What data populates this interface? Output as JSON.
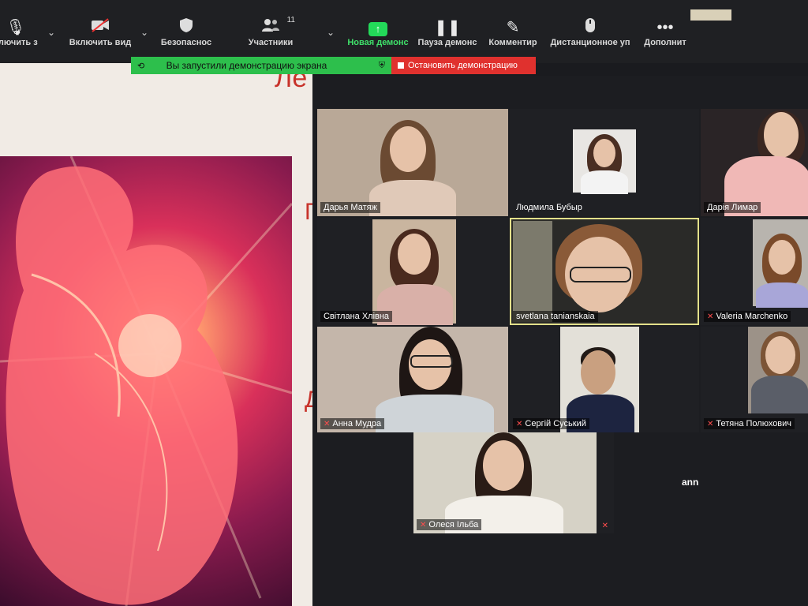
{
  "toolbar": {
    "items": [
      {
        "label": "ключить з",
        "icon": "mic-icon"
      },
      {
        "label": "Включить вид",
        "icon": "video-off-icon"
      },
      {
        "label": "Безопаснос",
        "icon": "shield-icon"
      },
      {
        "label": "Участники",
        "icon": "participants-icon",
        "count": "11"
      },
      {
        "label": "Новая демонс",
        "icon": "share-screen-icon"
      },
      {
        "label": "Пауза демонс",
        "icon": "pause-icon"
      },
      {
        "label": "Комментир",
        "icon": "pencil-icon"
      },
      {
        "label": "Дистанционное уп",
        "icon": "mouse-icon"
      },
      {
        "label": "Дополнит",
        "icon": "more-icon"
      }
    ]
  },
  "share_banner": {
    "text": "Вы запустили демонстрацию экрана",
    "stop_label": "Остановить демонстрацию"
  },
  "slide": {
    "title_fragment": "Ле",
    "side_letter_1": "Г",
    "side_letter_2": "Д"
  },
  "participants": [
    {
      "name": "Дарья Матяж",
      "muted": false
    },
    {
      "name": "Людмила Бубыр",
      "muted": false
    },
    {
      "name": "Дарія Лимар",
      "muted": false
    },
    {
      "name": "Світлана Хлівна",
      "muted": false
    },
    {
      "name": "svetlana tanianskaia",
      "muted": false
    },
    {
      "name": "Valeria Marchenko",
      "muted": true
    },
    {
      "name": "Анна Мудра",
      "muted": true
    },
    {
      "name": "Сергій Суський",
      "muted": true
    },
    {
      "name": "Тетяна Полюхович",
      "muted": true
    },
    {
      "name": "Олеся Ільба",
      "muted": true
    },
    {
      "name": "ann",
      "muted": true
    }
  ],
  "colors": {
    "share_green": "#2dbf4c",
    "stop_red": "#e0312e",
    "active_speaker": "#e3e08a"
  }
}
